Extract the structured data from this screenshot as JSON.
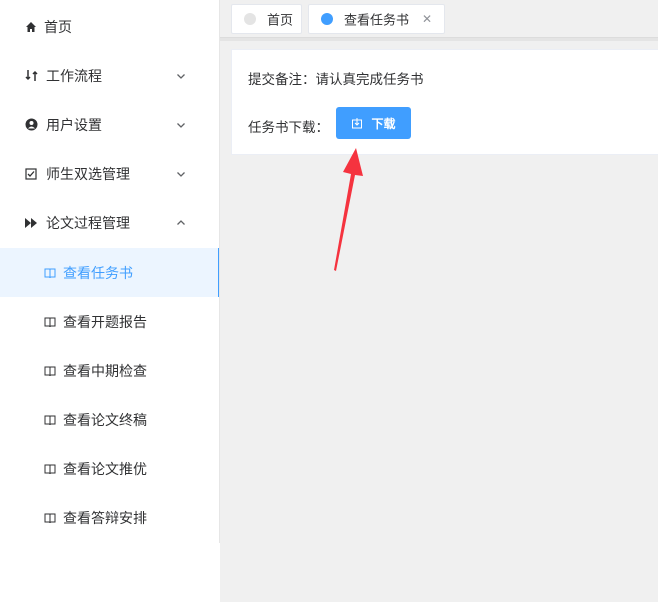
{
  "sidebar": {
    "items": [
      {
        "label": "首页",
        "icon": "home-icon"
      },
      {
        "label": "工作流程",
        "icon": "workflow-icon"
      },
      {
        "label": "用户设置",
        "icon": "user-circle-icon"
      },
      {
        "label": "师生双选管理",
        "icon": "checkbox-icon"
      },
      {
        "label": "论文过程管理",
        "icon": "fast-forward-icon"
      }
    ],
    "sub_items": [
      {
        "label": "查看任务书",
        "icon": "book-icon",
        "active": true
      },
      {
        "label": "查看开题报告",
        "icon": "book-icon"
      },
      {
        "label": "查看中期检查",
        "icon": "book-icon"
      },
      {
        "label": "查看论文终稿",
        "icon": "book-icon"
      },
      {
        "label": "查看论文推优",
        "icon": "book-icon"
      },
      {
        "label": "查看答辩安排",
        "icon": "book-icon"
      }
    ]
  },
  "tabs": [
    {
      "label": "首页"
    },
    {
      "label": "查看任务书",
      "active": true
    }
  ],
  "main": {
    "note": "提交备注：请认真完成任务书",
    "download_label": "任务书下载：",
    "download_button": "下载"
  },
  "colors": {
    "accent": "#409eff",
    "arrow": "#f5333f",
    "active_bg": "#ecf5ff"
  }
}
